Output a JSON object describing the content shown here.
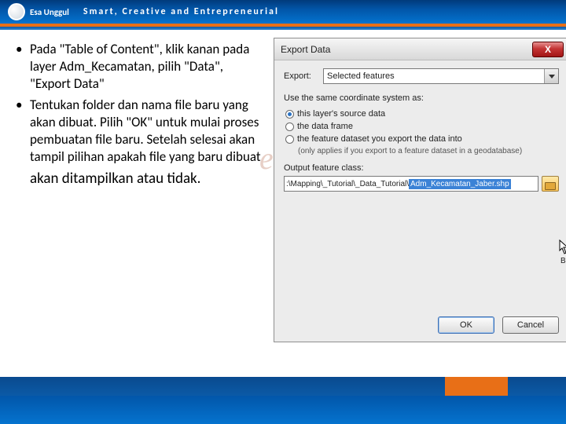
{
  "header": {
    "brand": "Esa Unggul",
    "tagline": "Smart, Creative and Entrepreneurial"
  },
  "bullets": {
    "items": [
      "Pada \"Table of Content\", klik kanan pada layer Adm_Kecamatan, pilih \"Data\", \"Export Data\"",
      "Tentukan folder dan nama file baru yang akan dibuat. Pilih \"OK\" untuk mulai proses pembuatan file baru. Setelah selesai akan tampil pilihan apakah file yang baru dibuat"
    ],
    "extra": "akan ditampilkan atau tidak."
  },
  "watermark": "espeta.blogspo",
  "dialog": {
    "title": "Export Data",
    "export_label": "Export:",
    "export_value": "Selected features",
    "coord_hint": "Use the same coordinate system as:",
    "radios": [
      {
        "label": "this layer's source data",
        "checked": true
      },
      {
        "label": "the data frame",
        "checked": false
      },
      {
        "label": "the feature dataset you export the data into",
        "checked": false
      }
    ],
    "radio_sub": "(only applies if you export to a feature dataset in a geodatabase)",
    "out_label": "Output feature class:",
    "path_prefix": ":\\Mapping\\_Tutorial\\_Data_Tutorial\\",
    "path_file": "Adm_Kecamatan_Jaber.shp",
    "browse_tip": "Br",
    "ok_label": "OK",
    "cancel_label": "Cancel",
    "close_label": "X"
  }
}
